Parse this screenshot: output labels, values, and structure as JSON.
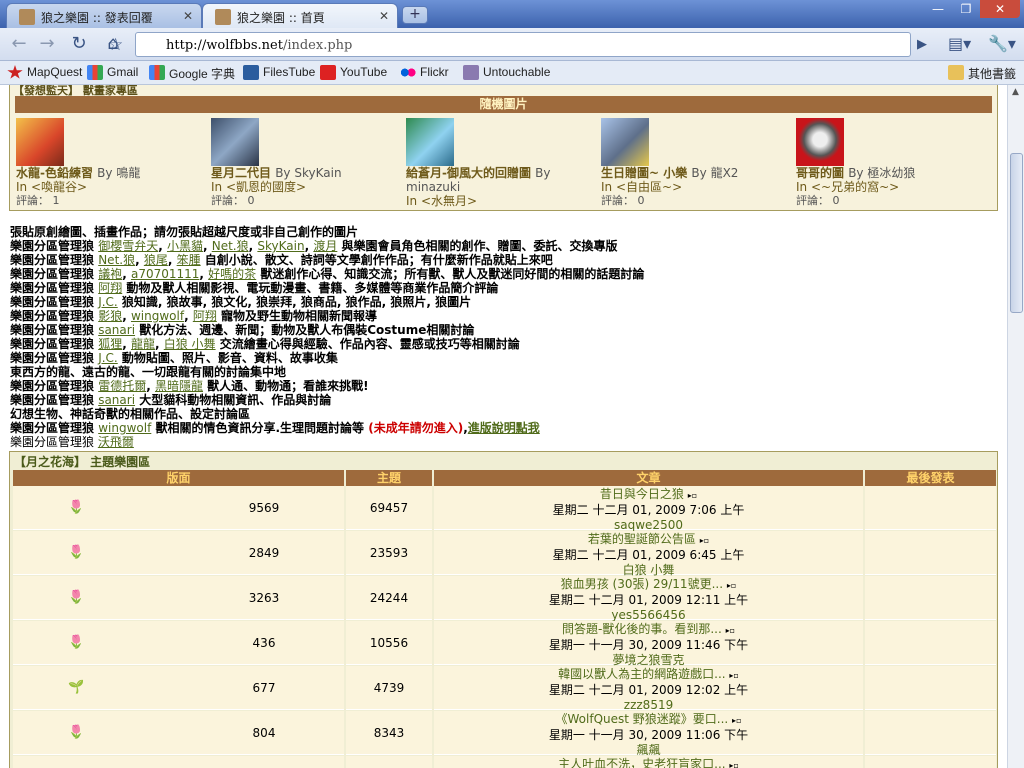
{
  "browser": {
    "tabs": [
      {
        "label": "狼之樂園 :: 發表回覆",
        "active": false
      },
      {
        "label": "狼之樂園 :: 首頁",
        "active": true
      }
    ],
    "url_host": "http://wolfbbs.net",
    "url_path": "/index.php",
    "bookmarks": [
      "MapQuest",
      "Gmail",
      "Google 字典",
      "FilesTube",
      "YouTube",
      "Flickr",
      "Untouchable"
    ],
    "other_bookmarks": "其他書籤"
  },
  "picbox": {
    "top_label": "【發想監天】 獸畫家專區",
    "title": "隨機圖片",
    "items": [
      {
        "title": "水龍-色鉛練習",
        "by": "By 鳴龍",
        "in_prefix": "In ",
        "in": "<喚龍谷>",
        "comments": "評論： 1"
      },
      {
        "title": "星月二代目",
        "by": "By SkyKain",
        "in_prefix": "In ",
        "in": "<凱恩的國度>",
        "comments": "評論： 0"
      },
      {
        "title": "給蒼月-御風大的回贈圖",
        "by": "By minazuki",
        "in_prefix": "In ",
        "in": "<水無月>",
        "comments": ""
      },
      {
        "title": "生日贈圖~ 小樂",
        "by": "By 龍X2",
        "in_prefix": "In ",
        "in": "<自由區~>",
        "comments": "評論： 0"
      },
      {
        "title": "哥哥的圖",
        "by": "By 極冰幼狼",
        "in_prefix": "In ",
        "in": "<~兄弟的窩~>",
        "comments": "評論： 0"
      }
    ]
  },
  "desc": {
    "l1": "張貼原創繪圖、插畫作品；請勿張貼超越尺度或非自己創作的圖片",
    "mgr": "樂園分區管理狼",
    "l2_mods": [
      "御櫻雪弁天",
      "小黑貓",
      "Net.狼",
      "SkyKain",
      "渡月"
    ],
    "l2_text": " 與樂園會員角色相關的創作、贈圖、委託、交換專版",
    "l3_mods": [
      "Net.狼",
      "狼尾",
      "笨腫"
    ],
    "l3_text": " 自創小說、散文、詩詞等文學創作作品；有什麼新作品就貼上來吧",
    "l4_mods": [
      "議袍",
      "a70701111",
      "好嗎的茶"
    ],
    "l4_text": " 獸迷創作心得、知識交流；所有獸、獸人及獸迷同好間的相關的話題討論",
    "l5_mods": [
      "阿翔"
    ],
    "l5_text": " 動物及獸人相關影視、電玩動漫畫、書籍、多媒體等商業作品簡介評論",
    "l6_mods": [
      "J.C."
    ],
    "l6_text": " 狼知識, 狼故事, 狼文化, 狼崇拜, 狼商品, 狼作品, 狼照片, 狼圖片",
    "l7_mods": [
      "影狼",
      "wingwolf",
      "阿翔"
    ],
    "l7_text": " 寵物及野生動物相關新聞報導",
    "l8_mods": [
      "sanari"
    ],
    "l8_text": " 獸化方法、週邊、新聞；動物及獸人布偶裝Costume相關討論",
    "l9_mods": [
      "狐狸",
      "龍龍",
      "白狼 小舞"
    ],
    "l9_text": " 交流繪畫心得與經驗、作品內容、靈感或技巧等相關討論",
    "l10_mods": [
      "J.C."
    ],
    "l10_text": " 動物貼圖、照片、影音、資料、故事收集",
    "l11": "東西方的龍、遠古的龍、一切跟龍有關的討論集中地",
    "l12_mods": [
      "雷德托爾",
      "黑暗隱龍"
    ],
    "l12_text": " 獸人通、動物通；看誰來挑戰!",
    "l13_mods": [
      "sanari"
    ],
    "l13_text": " 大型貓科動物相關資訊、作品與討論",
    "l14": "幻想生物、神話奇獸的相關作品、設定討論區",
    "l15_mods": [
      "wingwolf"
    ],
    "l15_text": " 獸相關的情色資訊分享.生理問題討論等 ",
    "l15_red": "(未成年請勿進入)",
    "l15_link": "進版說明點我",
    "l16_mods": [
      "沃飛爾"
    ]
  },
  "forum": {
    "category": "【月之花海】 主題樂園區",
    "headers": [
      "版面",
      "主題",
      "文章",
      "最後發表"
    ],
    "rows": [
      {
        "topics": "9569",
        "posts": "69457",
        "last_title": "昔日與今日之狼 ",
        "last_time": "星期二 十二月 01, 2009 7:06 上午",
        "last_user": "saqwe2500",
        "flower": "🌷"
      },
      {
        "topics": "2849",
        "posts": "23593",
        "last_title": "若葉的聖誕節公告區 ",
        "last_time": "星期二 十二月 01, 2009 6:45 上午",
        "last_user": "白狼 小舞",
        "flower": "🌷"
      },
      {
        "topics": "3263",
        "posts": "24244",
        "last_title": "狼血男孩 (30張) 29/11號更... ",
        "last_time": "星期二 十二月 01, 2009 12:11 上午",
        "last_user": "yes5566456",
        "flower": "🌷"
      },
      {
        "topics": "436",
        "posts": "10556",
        "last_title": "問答題-獸化後的事。看到那... ",
        "last_time": "星期一 十一月 30, 2009 11:46 下午",
        "last_user": "夢境之狼雪克",
        "flower": "🌷"
      },
      {
        "topics": "677",
        "posts": "4739",
        "last_title": "韓國以獸人為主的網路遊戲口... ",
        "last_time": "星期二 十二月 01, 2009 12:02 上午",
        "last_user": "zzz8519",
        "flower": "🌱"
      },
      {
        "topics": "804",
        "posts": "8343",
        "last_title": "《WolfQuest 野狼迷蹤》要口... ",
        "last_time": "星期一 十一月 30, 2009 11:06 下午",
        "last_user": "飆飆",
        "flower": "🌷"
      },
      {
        "topics": "",
        "posts": "",
        "last_title": "主人叶血不洗，史老狂盲家口... ",
        "last_time": "",
        "last_user": "",
        "flower": ""
      }
    ]
  },
  "colors": {
    "accent": "#9e6a3c",
    "link": "#506b1a",
    "panel": "#f7f2dc"
  }
}
